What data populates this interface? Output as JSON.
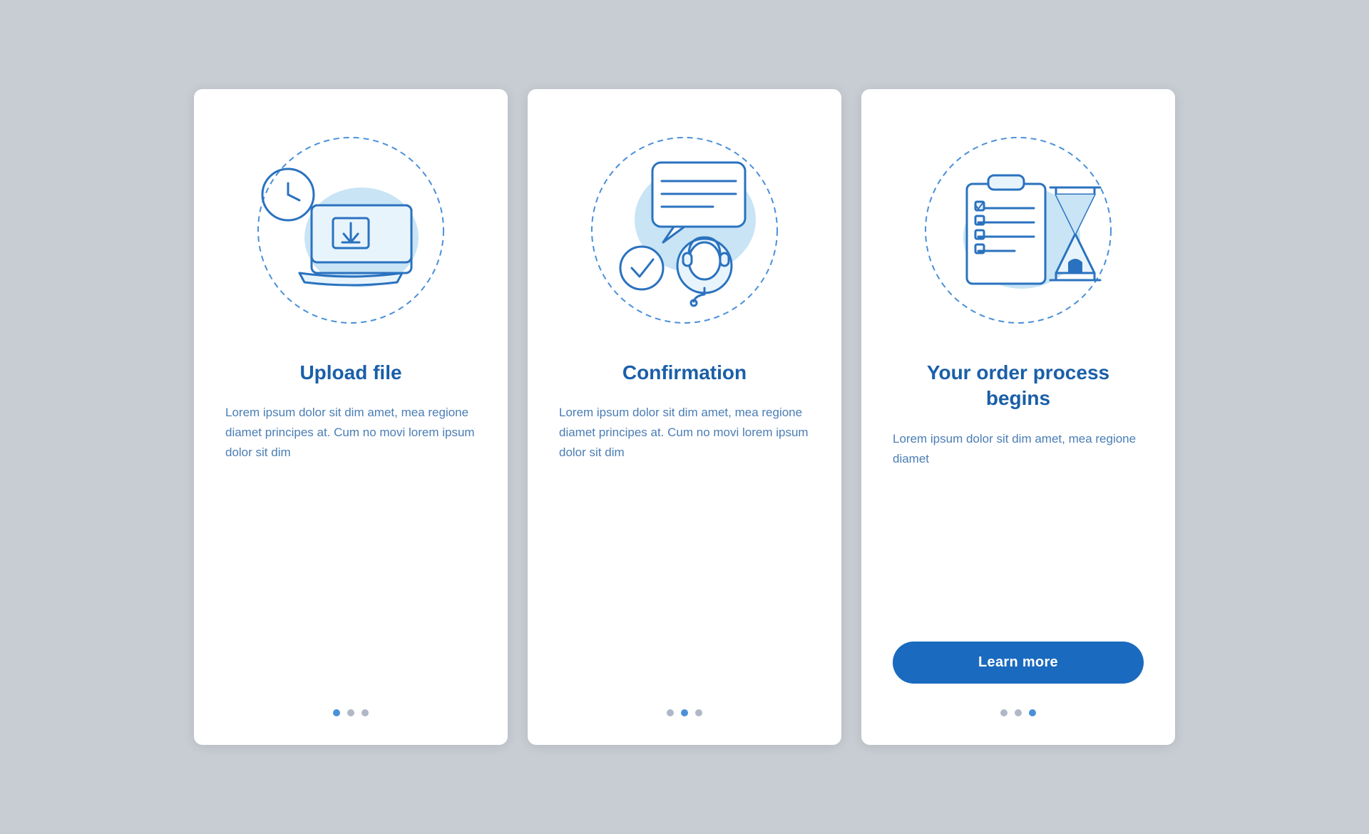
{
  "cards": [
    {
      "id": "upload-file",
      "title": "Upload file",
      "body": "Lorem ipsum dolor sit dim amet, mea regione diamet principes at. Cum no movi lorem ipsum dolor sit dim",
      "dots": [
        true,
        false,
        false
      ],
      "showButton": false,
      "buttonLabel": null
    },
    {
      "id": "confirmation",
      "title": "Confirmation",
      "body": "Lorem ipsum dolor sit dim amet, mea regione diamet principes at. Cum no movi lorem ipsum dolor sit dim",
      "dots": [
        false,
        true,
        false
      ],
      "showButton": false,
      "buttonLabel": null
    },
    {
      "id": "order-process",
      "title": "Your order process begins",
      "body": "Lorem ipsum dolor sit dim amet, mea regione diamet",
      "dots": [
        false,
        false,
        true
      ],
      "showButton": true,
      "buttonLabel": "Learn more"
    }
  ]
}
